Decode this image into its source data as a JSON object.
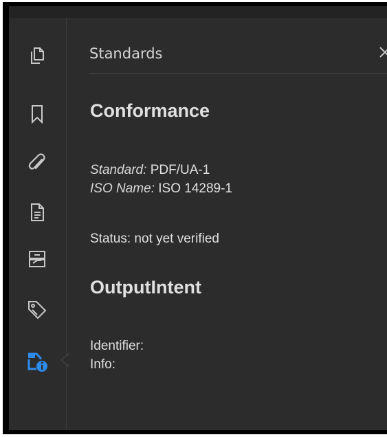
{
  "panel": {
    "title": "Standards",
    "close_icon": "close-icon"
  },
  "rail": {
    "items": [
      {
        "name": "pages-thumbnails",
        "icon": "copy-pages-icon",
        "active": false
      },
      {
        "name": "bookmarks",
        "icon": "bookmark-icon",
        "active": false
      },
      {
        "name": "attachments",
        "icon": "paperclip-icon",
        "active": false
      },
      {
        "name": "document-properties",
        "icon": "document-icon",
        "active": false
      },
      {
        "name": "layers",
        "icon": "layers-icon",
        "active": false
      },
      {
        "name": "tags",
        "icon": "tag-icon",
        "active": false
      },
      {
        "name": "standards",
        "icon": "standards-info-icon",
        "active": true
      }
    ]
  },
  "conformance": {
    "heading": "Conformance",
    "standard_key": "Standard:",
    "standard_value": "PDF/UA-1",
    "iso_key": "ISO Name:",
    "iso_value": "ISO 14289-1",
    "status": "Status: not yet verified"
  },
  "output_intent": {
    "heading": "OutputIntent",
    "identifier": "Identifier:",
    "info": "Info:"
  },
  "colors": {
    "background": "#2c2c2c",
    "text": "#e0e0e0",
    "icon": "#c8c8c8",
    "accent": "#2d8ceb"
  }
}
